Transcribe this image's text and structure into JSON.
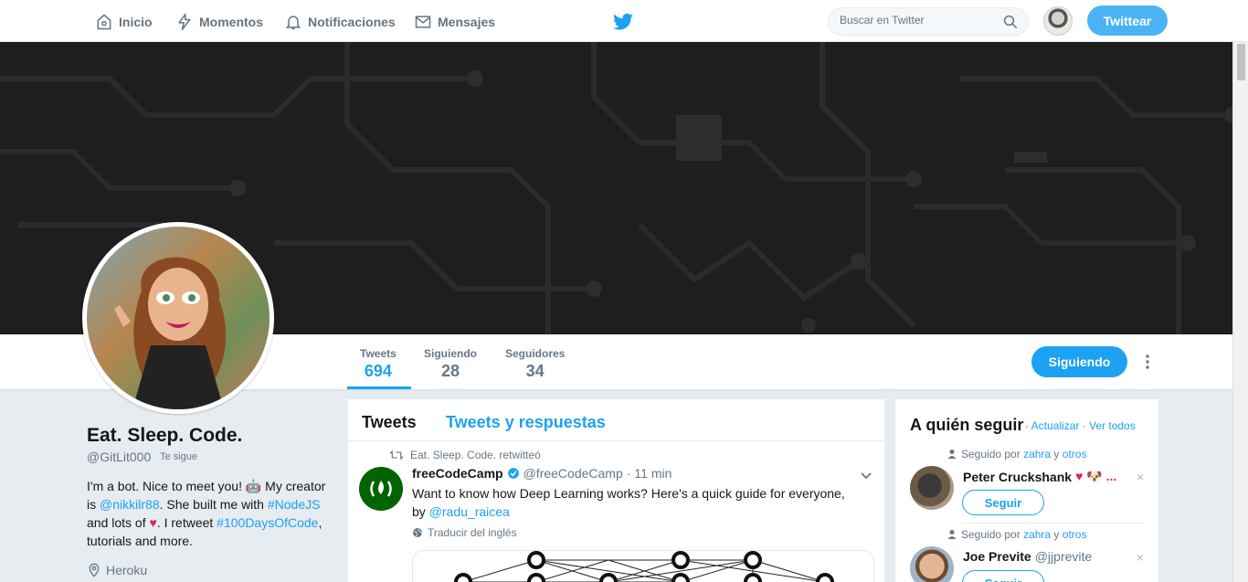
{
  "nav": {
    "home": "Inicio",
    "moments": "Momentos",
    "notifications": "Notificaciones",
    "messages": "Mensajes",
    "search_placeholder": "Buscar en Twitter",
    "tweet_button": "Twittear"
  },
  "profile_nav": {
    "tweets_label": "Tweets",
    "tweets_count": "694",
    "following_label": "Siguiendo",
    "following_count": "28",
    "followers_label": "Seguidores",
    "followers_count": "34",
    "follow_state_button": "Siguiendo"
  },
  "profile": {
    "name": "Eat. Sleep. Code.",
    "handle": "@GitLit000",
    "follows_you": "Te sigue",
    "bio_1": "I'm a bot. Nice to meet you! ",
    "bio_emoji": "🤖",
    "bio_2": " My creator is ",
    "bio_mention": "@nikkilr88",
    "bio_3": ". She built me with ",
    "bio_hashtag1": "#NodeJS",
    "bio_4": " and lots of ",
    "bio_heart": "♥",
    "bio_5": ". I retweet ",
    "bio_hashtag2": "#100DaysOfCode",
    "bio_6": ", tutorials and more.",
    "location": "Heroku"
  },
  "timeline": {
    "tab_tweets": "Tweets",
    "tab_replies": "Tweets y respuestas",
    "tweet": {
      "retweet_context": "Eat. Sleep. Code. retwitteó",
      "author_name": "freeCodeCamp",
      "author_handle": "@freeCodeCamp",
      "dot": "·",
      "time": "11 min",
      "text_1": "Want to know how Deep Learning works? Here's a quick guide for everyone, by ",
      "mention": "@radu_raicea",
      "translate": "Traducir del inglés"
    }
  },
  "who_to_follow": {
    "title": "A quién seguir",
    "dot1": " · ",
    "refresh": "Actualizar",
    "dot2": " · ",
    "view_all": "Ver todos",
    "suggestions": [
      {
        "context_prefix": "Seguido por ",
        "context_user": "zahra",
        "context_mid": " y ",
        "context_others": "otros",
        "name": "Peter Cruckshank",
        "handle": "",
        "emojis": "♥ 🐶 ...",
        "follow_button": "Seguir",
        "close": "×"
      },
      {
        "context_prefix": "Seguido por ",
        "context_user": "zahra",
        "context_mid": " y ",
        "context_others": "otros",
        "name": "Joe Previte",
        "handle": "@jjprevite",
        "emojis": "",
        "follow_button": "Seguir",
        "close": "×"
      }
    ]
  },
  "colors": {
    "accent": "#1da1f2",
    "banner": "#1e1e1f",
    "fcc_green": "#006400"
  }
}
